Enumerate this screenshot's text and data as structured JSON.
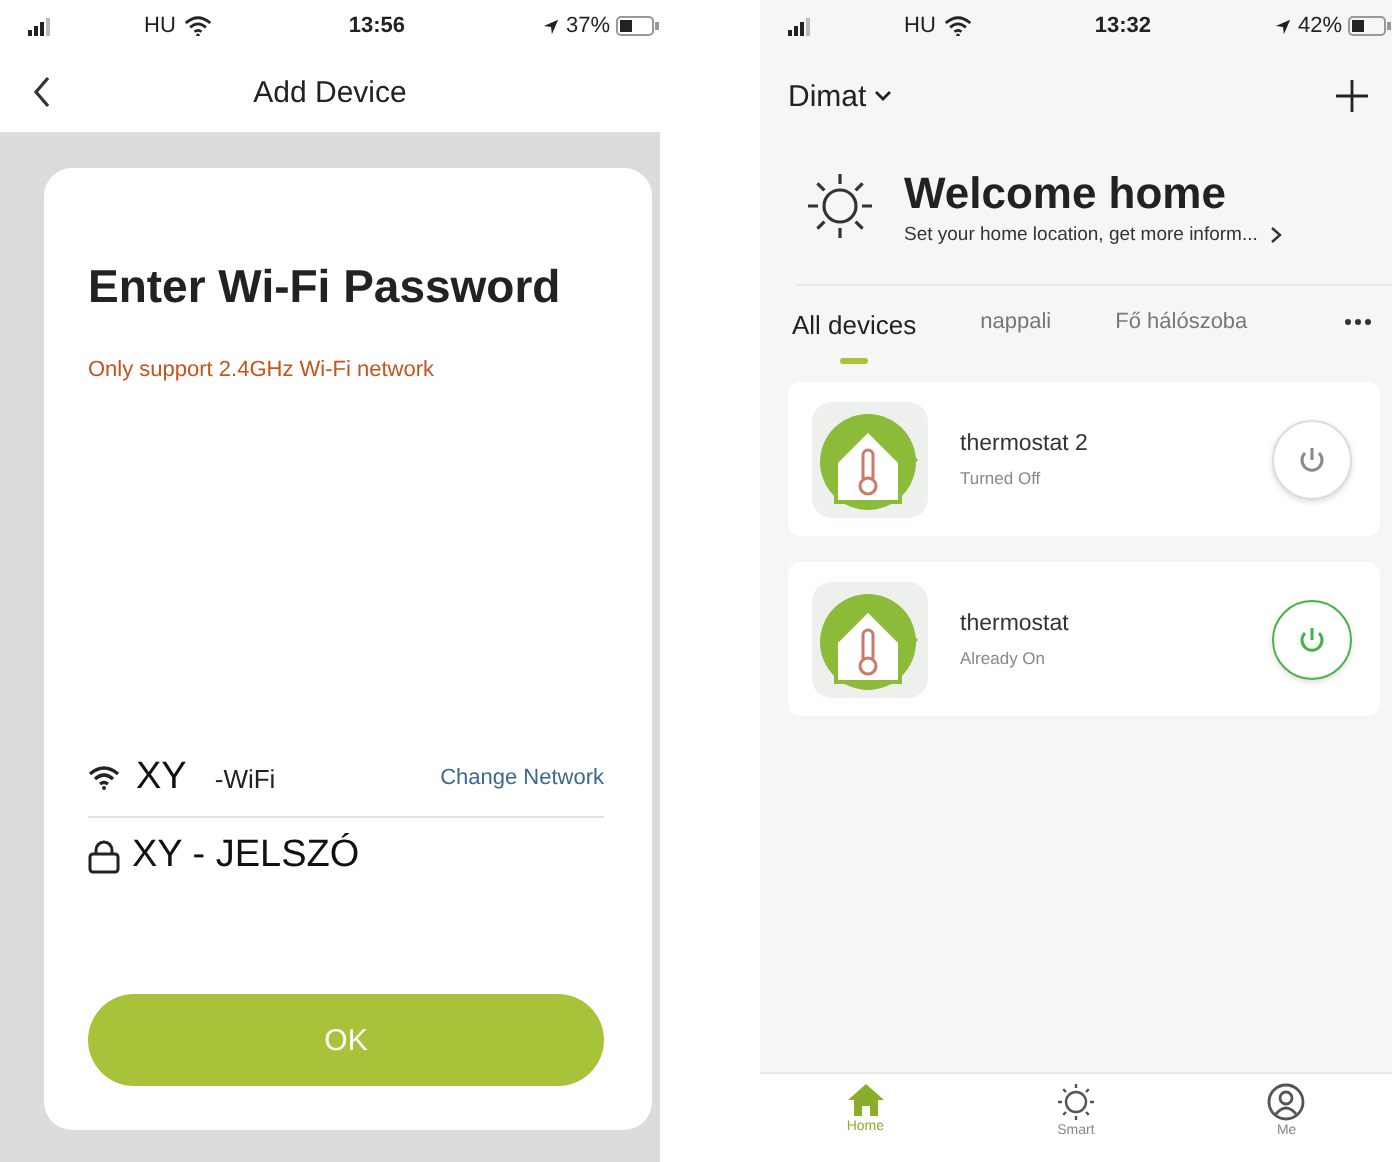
{
  "left_screen": {
    "status_bar": {
      "carrier": "HU",
      "time": "13:56",
      "battery": "37%"
    },
    "header": {
      "title": "Add Device"
    },
    "card": {
      "title": "Enter Wi-Fi Password",
      "warning": "Only support 2.4GHz Wi-Fi network",
      "network_name": "XY",
      "network_suffix": "-WiFi",
      "change_link": "Change Network",
      "password": "XY - JELSZÓ",
      "ok_button": "OK"
    }
  },
  "right_screen": {
    "status_bar": {
      "carrier": "HU",
      "time": "13:32",
      "battery": "42%"
    },
    "home_name": "Dimat",
    "welcome": {
      "title": "Welcome home",
      "subtitle": "Set your home location, get more inform..."
    },
    "tabs": [
      {
        "label": "All devices",
        "selected": true
      },
      {
        "label": "nappali",
        "selected": false
      },
      {
        "label": "Fő hálószoba",
        "selected": false
      }
    ],
    "devices": [
      {
        "name": "thermostat 2",
        "status": "Turned Off",
        "on": false
      },
      {
        "name": "thermostat",
        "status": "Already On",
        "on": true
      }
    ],
    "nav": [
      {
        "label": "Home",
        "kind": "home",
        "selected": true
      },
      {
        "label": "Smart",
        "kind": "smart",
        "selected": false
      },
      {
        "label": "Me",
        "kind": "me",
        "selected": false
      }
    ]
  }
}
